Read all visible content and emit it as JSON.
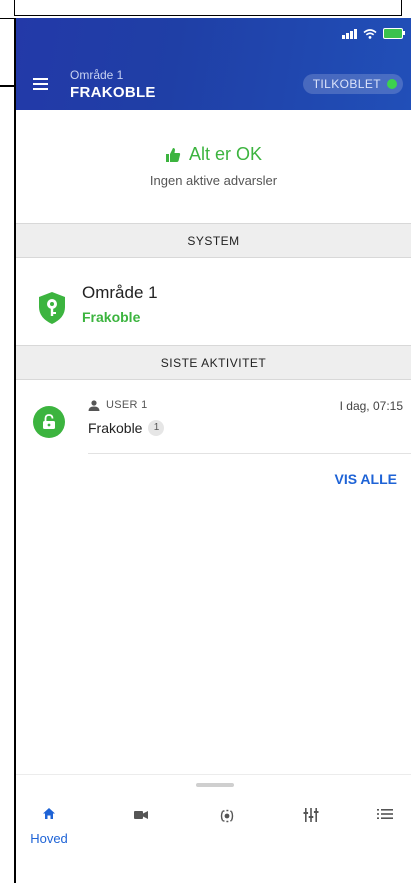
{
  "status_bar": {
    "signal_label": "signal",
    "wifi_label": "wifi",
    "battery_label": "battery"
  },
  "header": {
    "subtitle": "Område 1",
    "title": "FRAKOBLE",
    "connection_status": "TILKOBLET",
    "connection_color": "#3cd24e",
    "menu_icon": "hamburger-icon",
    "gradient": [
      "#2339a8",
      "#214fb8"
    ]
  },
  "status": {
    "title": "Alt er OK",
    "subtitle": "Ingen aktive advarsler",
    "icon": "thumbs-up-icon",
    "color": "#3cb43f"
  },
  "system_section": {
    "header": "SYSTEM",
    "area": {
      "name": "Område 1",
      "state": "Frakoble",
      "icon": "shield-key-icon"
    }
  },
  "activity_section": {
    "header": "SISTE AKTIVITET",
    "items": [
      {
        "user": "USER 1",
        "time": "I dag, 07:15",
        "action": "Frakoble",
        "count": "1",
        "icon": "unlock-icon"
      }
    ],
    "view_all": "VIS ALLE"
  },
  "bottom_nav": {
    "items": [
      {
        "label": "Hoved",
        "icon": "home-icon",
        "active": true
      },
      {
        "label": "",
        "icon": "camera-icon",
        "active": false
      },
      {
        "label": "",
        "icon": "sensor-icon",
        "active": false
      },
      {
        "label": "",
        "icon": "equalizer-icon",
        "active": false
      },
      {
        "label": "",
        "icon": "list-icon",
        "active": false
      }
    ],
    "active_color": "#1e63d6"
  }
}
